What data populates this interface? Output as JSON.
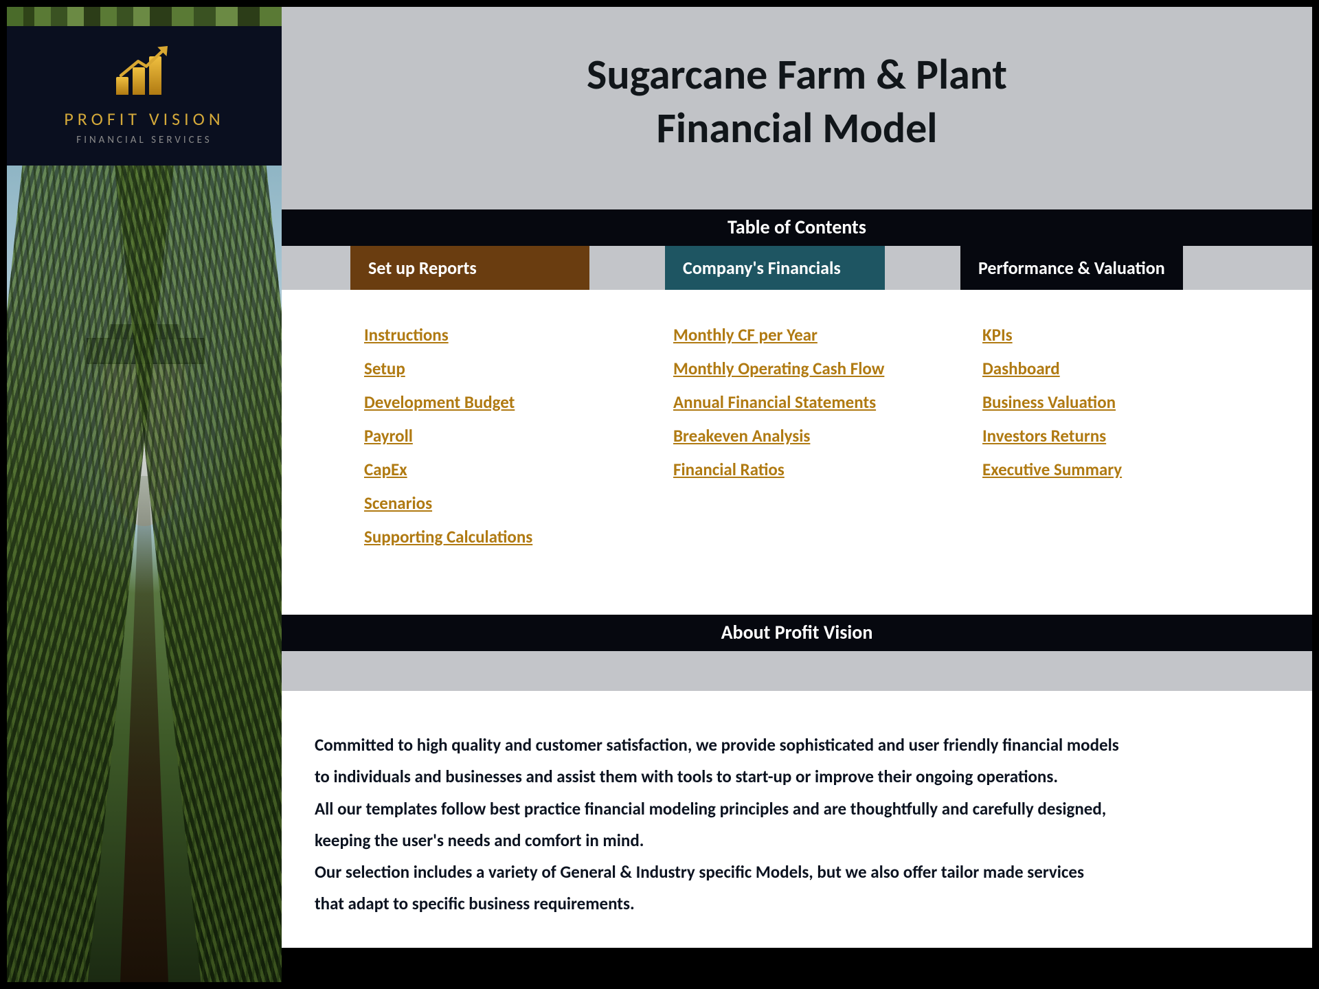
{
  "brand": {
    "name": "PROFIT VISION",
    "subtitle": "FINANCIAL SERVICES"
  },
  "title": {
    "line1": "Sugarcane Farm & Plant",
    "line2": "Financial Model"
  },
  "sections": {
    "toc_header": "Table of Contents",
    "about_header": "About Profit Vision"
  },
  "tabs": {
    "setup": "Set up Reports",
    "financials": "Company's Financials",
    "performance": "Performance & Valuation"
  },
  "toc": {
    "col1": [
      "Instructions",
      "Setup",
      "Development Budget",
      "Payroll",
      "CapEx",
      "Scenarios",
      "Supporting Calculations"
    ],
    "col2": [
      "Monthly CF per Year",
      "Monthly Operating Cash Flow",
      "Annual Financial Statements",
      "Breakeven Analysis",
      "Financial Ratios"
    ],
    "col3": [
      "KPIs",
      "Dashboard",
      "Business Valuation",
      "Investors Returns",
      "Executive Summary"
    ]
  },
  "about": {
    "p1": "Committed to high quality and customer satisfaction, we provide sophisticated and user friendly financial models",
    "p2": "to individuals and businesses and assist them  with tools to start-up or improve their ongoing operations.",
    "p3": "All our templates follow best practice financial modeling principles and are thoughtfully and carefully designed,",
    "p4": "keeping the user's needs and comfort in mind.",
    "p5": "Our selection includes a variety of General & Industry specific Models, but we also offer tailor made services",
    "p6": "that adapt to specific business requirements."
  }
}
